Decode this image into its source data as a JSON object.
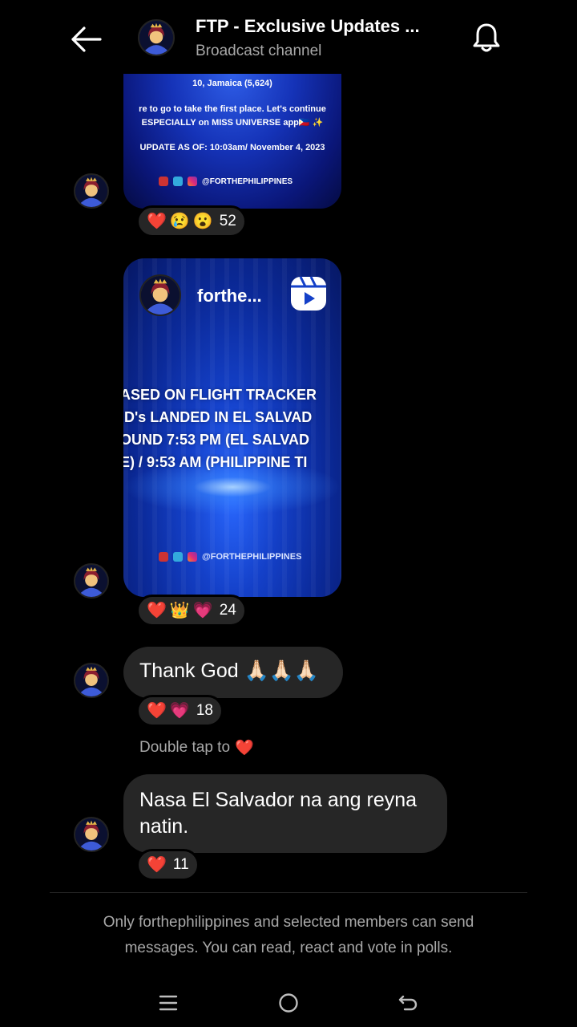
{
  "header": {
    "title": "FTP - Exclusive Updates ...",
    "subtitle": "Broadcast channel"
  },
  "card1": {
    "lines": [
      "10, Jamaica (5,624)",
      "re to go to take the first place. Let's continue",
      "ESPECIALLY on MISS UNIVERSE app🇵🇭 ✨",
      "UPDATE AS OF: 10:03am/ November 4, 2023"
    ],
    "handle": "@FORTHEPHILIPPINES",
    "reactions": {
      "emojis": [
        "❤️",
        "😢",
        "😮"
      ],
      "count": "52"
    }
  },
  "card2": {
    "username": "forthe...",
    "lines": [
      "ASED ON FLIGHT TRACKER",
      "ID's LANDED IN EL SALVAD",
      "OUND 7:53 PM (EL SALVAD",
      "E) / 9:53 AM (PHILIPPINE TI"
    ],
    "handle": "@FORTHEPHILIPPINES",
    "reactions": {
      "emojis": [
        "❤️",
        "👑",
        "💗"
      ],
      "count": "24"
    }
  },
  "message1": {
    "text": "Thank God 🙏🏻🙏🏻🙏🏻",
    "reactions": {
      "emojis": [
        "❤️",
        "💗"
      ],
      "count": "18"
    },
    "hint": "Double tap to",
    "hint_emoji": "❤️"
  },
  "message2": {
    "text": "Nasa El Salvador na ang reyna natin.",
    "reactions": {
      "emojis": [
        "❤️"
      ],
      "count": "11"
    }
  },
  "footer": {
    "note": "Only forthephilippines and selected members can send messages. You can read, react and vote in polls."
  },
  "icons": {
    "back": "arrow-left-icon",
    "bell": "bell-icon",
    "reel": "reels-icon",
    "nav_menu": "menu-icon",
    "nav_home": "home-circle-icon",
    "nav_back": "back-icon"
  },
  "colors": {
    "background": "#000000",
    "bubble": "#262626",
    "secondary_text": "#a8a8a8",
    "card_blue": "#1440c8"
  }
}
